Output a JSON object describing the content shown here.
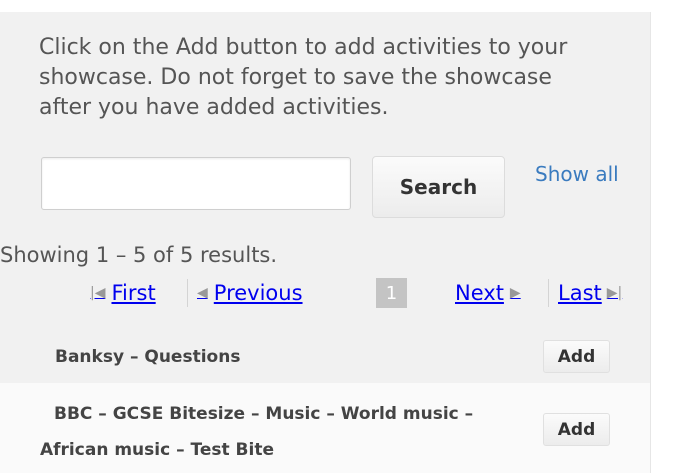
{
  "instructions": "Click on the Add button to add activities to your showcase. Do not forget to save the showcase after you have added activities.",
  "search": {
    "value": "",
    "placeholder": "",
    "button_label": "Search",
    "show_all_label": "Show all"
  },
  "results": {
    "summary": "Showing 1 – 5 of 5 results."
  },
  "pagination": {
    "first_label": "First",
    "previous_label": "Previous",
    "current_page": "1",
    "next_label": "Next",
    "last_label": "Last"
  },
  "activities": [
    {
      "title": "Banksy – Questions",
      "add_label": "Add"
    },
    {
      "title": "BBC – GCSE Bitesize – Music – World music – African music – Test Bite",
      "add_label": "Add"
    }
  ],
  "colors": {
    "link": "#3a7bbf",
    "panel_bg": "#f1f1f1",
    "current_page_bg": "#c4c4c4"
  }
}
